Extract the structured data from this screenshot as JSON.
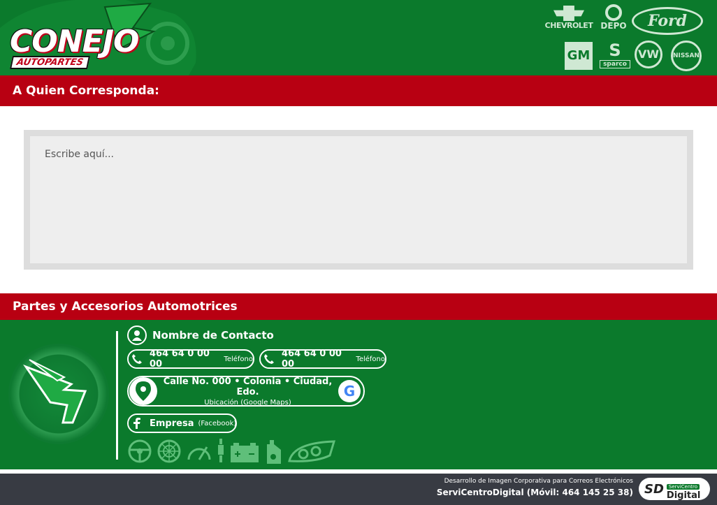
{
  "header": {
    "logo_text": "CONEJO",
    "logo_sub": "AUTOPARTES",
    "brands": [
      "CHEVROLET",
      "DEPO",
      "Ford",
      "GM",
      "sparco",
      "VW",
      "NISSAN"
    ]
  },
  "greeting": "A Quien Corresponda:",
  "message": {
    "placeholder": "Escribe aquí..."
  },
  "section_title": "Partes y Accesorios Automotrices",
  "contact": {
    "name": "Nombre de Contacto",
    "phones": [
      {
        "number": "464 64 0 00 00",
        "tag": "Teléfono"
      },
      {
        "number": "464 64 0 00 00",
        "tag": "Teléfono"
      }
    ],
    "address": "Calle No. 000 • Colonia • Ciudad, Edo.",
    "address_tag": "Ubicación (Google Maps)",
    "facebook_name": "Empresa",
    "facebook_tag": "(Facebook)"
  },
  "credit": {
    "line1": "Desarrollo de Imagen Corporativa para Correos Electrónicos",
    "line2": "ServiCentroDigital (Móvil: 464 145 25 38)",
    "logo_small": "ServiCentro",
    "logo_big": "Digital"
  },
  "colors": {
    "green": "#0b7a2c",
    "red": "#b80012",
    "dark": "#383b43"
  },
  "icons": [
    "user-icon",
    "phone-icon",
    "map-pin-icon",
    "google-icon",
    "facebook-icon",
    "steering-wheel-icon",
    "wheel-icon",
    "gauge-icon",
    "spark-plug-icon",
    "battery-icon",
    "oil-can-icon",
    "headlight-icon"
  ]
}
